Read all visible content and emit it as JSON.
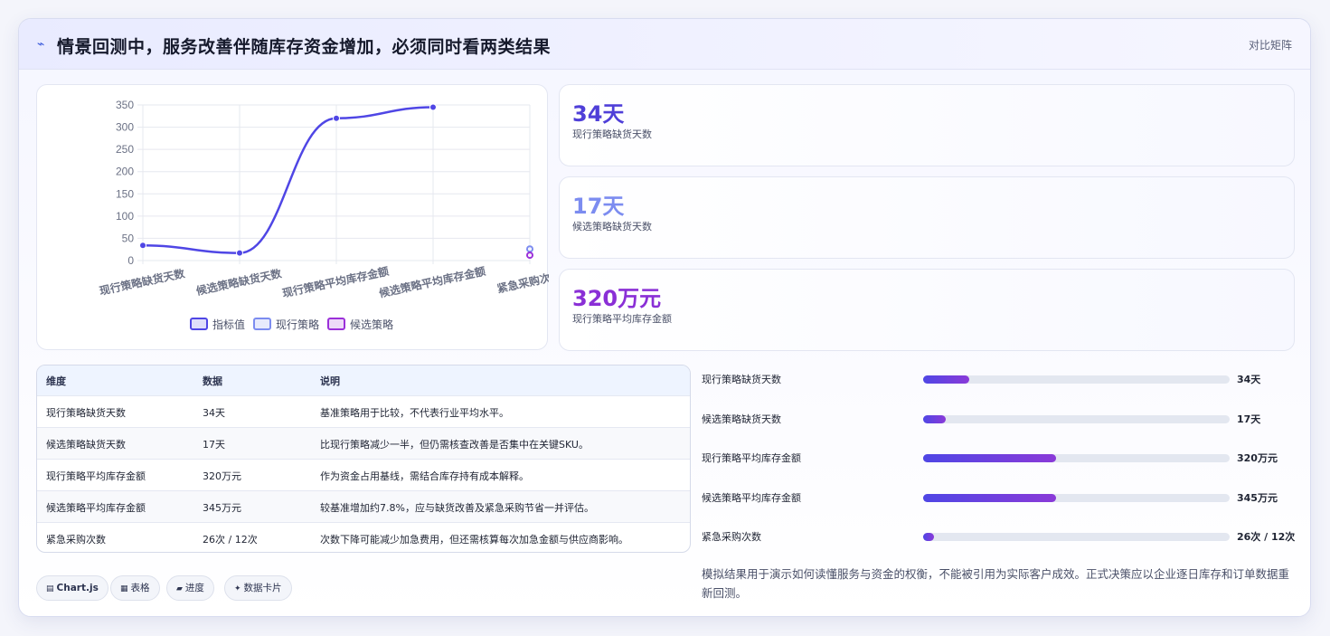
{
  "header": {
    "title": "情景回测中，服务改善伴随库存资金增加，必须同时看两类结果",
    "matrix_link": "对比矩阵"
  },
  "chart_data": {
    "type": "line",
    "categories": [
      "现行策略缺货天数",
      "候选策略缺货天数",
      "现行策略平均库存金额",
      "候选策略平均库存金额",
      "紧急采购次数"
    ],
    "series": [
      {
        "name": "指标值",
        "values": [
          34,
          17,
          320,
          345,
          null
        ],
        "color": "#4f46e5"
      },
      {
        "name": "现行策略",
        "values": [
          null,
          null,
          null,
          null,
          26
        ],
        "color": "#7c8cf0"
      },
      {
        "name": "候选策略",
        "values": [
          null,
          null,
          null,
          null,
          12
        ],
        "color": "#9b30d9"
      }
    ],
    "ylim": [
      0,
      350
    ],
    "yticks": [
      0,
      50,
      100,
      150,
      200,
      250,
      300,
      350
    ],
    "grid": true,
    "legend": "bottom"
  },
  "stats": [
    {
      "value": "34天",
      "label": "现行策略缺货天数",
      "color": "#4f3fd8"
    },
    {
      "value": "17天",
      "label": "候选策略缺货天数",
      "color": "#7c8cf0"
    },
    {
      "value": "320万元",
      "label": "现行策略平均库存金额",
      "color": "#8a2fd6"
    }
  ],
  "table": {
    "headers": [
      "维度",
      "数据",
      "说明"
    ],
    "rows": [
      [
        "现行策略缺货天数",
        "34天",
        "基准策略用于比较，不代表行业平均水平。"
      ],
      [
        "候选策略缺货天数",
        "17天",
        "比现行策略减少一半，但仍需核查改善是否集中在关键SKU。"
      ],
      [
        "现行策略平均库存金额",
        "320万元",
        "作为资金占用基线，需结合库存持有成本解释。"
      ],
      [
        "候选策略平均库存金额",
        "345万元",
        "较基准增加约7.8%，应与缺货改善及紧急采购节省一并评估。"
      ],
      [
        "紧急采购次数",
        "26次 / 12次",
        "次数下降可能减少加急费用，但还需核算每次加急金额与供应商影响。"
      ]
    ]
  },
  "progress": [
    {
      "label": "现行策略缺货天数",
      "value": "34天",
      "fraction": 0.15
    },
    {
      "label": "候选策略缺货天数",
      "value": "17天",
      "fraction": 0.075
    },
    {
      "label": "现行策略平均库存金额",
      "value": "320万元",
      "fraction": 0.435
    },
    {
      "label": "候选策略平均库存金额",
      "value": "345万元",
      "fraction": 0.435
    },
    {
      "label": "紧急采购次数",
      "value": "26次 / 12次",
      "fraction": 0.035
    }
  ],
  "note": "模拟结果用于演示如何读懂服务与资金的权衡，不能被引用为实际客户成效。正式决策应以企业逐日库存和订单数据重新回测。",
  "chips": [
    {
      "icon": "chart-icon",
      "glyph": "▤",
      "label": "Chart.js"
    },
    {
      "icon": "table-icon",
      "glyph": "▦",
      "label": "表格"
    },
    {
      "icon": "progress-icon",
      "glyph": "▰",
      "label": "进度"
    },
    {
      "icon": "card-icon",
      "glyph": "✦",
      "label": "数据卡片"
    }
  ]
}
